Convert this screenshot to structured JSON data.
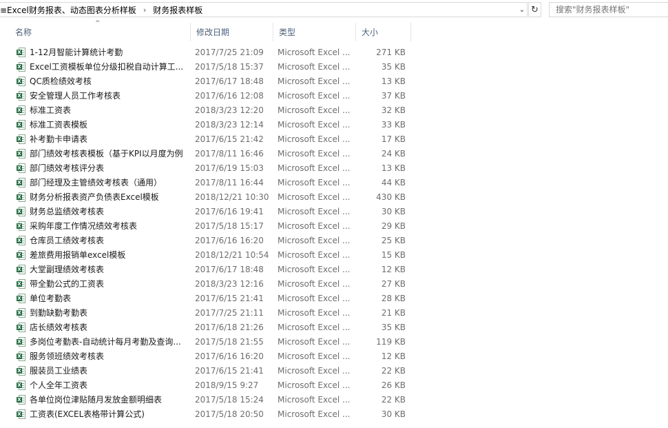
{
  "address": {
    "crumbs": [
      "≡Excel财务报表、动态图表分析样板",
      "财务报表样板"
    ],
    "separator": "›",
    "dropdown_icon": "chevron-down-icon",
    "refresh_icon": "refresh-icon"
  },
  "search": {
    "placeholder": "搜索\"财务报表样板\""
  },
  "columns": {
    "name": "名称",
    "date": "修改日期",
    "type": "类型",
    "size": "大小",
    "sort_indicator": "^"
  },
  "files": [
    {
      "name": "1-12月智能计算统计考勤",
      "date": "2017/7/25 21:09",
      "type": "Microsoft Excel ...",
      "size": "271 KB"
    },
    {
      "name": "Excel工资模板单位分级扣税自动计算工...",
      "date": "2017/5/18 15:37",
      "type": "Microsoft Excel ...",
      "size": "35 KB"
    },
    {
      "name": "QC质检绩效考核",
      "date": "2017/6/17 18:48",
      "type": "Microsoft Excel ...",
      "size": "13 KB"
    },
    {
      "name": "安全管理人员工作考核表",
      "date": "2017/6/16 12:08",
      "type": "Microsoft Excel ...",
      "size": "37 KB"
    },
    {
      "name": "标准工资表",
      "date": "2018/3/23 12:20",
      "type": "Microsoft Excel ...",
      "size": "32 KB"
    },
    {
      "name": "标准工资表模板",
      "date": "2018/3/23 12:14",
      "type": "Microsoft Excel ...",
      "size": "33 KB"
    },
    {
      "name": "补考勤卡申请表",
      "date": "2017/6/15 21:42",
      "type": "Microsoft Excel ...",
      "size": "17 KB"
    },
    {
      "name": "部门绩效考核表模板（基于KPI以月度为例",
      "date": "2017/8/11 16:46",
      "type": "Microsoft Excel ...",
      "size": "24 KB"
    },
    {
      "name": "部门绩效考核评分表",
      "date": "2017/6/19 15:03",
      "type": "Microsoft Excel ...",
      "size": "13 KB"
    },
    {
      "name": "部门经理及主管绩效考核表（通用）",
      "date": "2017/8/11 16:44",
      "type": "Microsoft Excel ...",
      "size": "44 KB"
    },
    {
      "name": "财务分析报表资产负债表Excel模板",
      "date": "2018/12/21 10:30",
      "type": "Microsoft Excel ...",
      "size": "430 KB"
    },
    {
      "name": "财务总监绩效考核表",
      "date": "2017/6/16 19:41",
      "type": "Microsoft Excel ...",
      "size": "30 KB"
    },
    {
      "name": "采购年度工作情况绩效考核表",
      "date": "2017/5/18 15:17",
      "type": "Microsoft Excel ...",
      "size": "29 KB"
    },
    {
      "name": "仓库员工绩效考核表",
      "date": "2017/6/16 16:20",
      "type": "Microsoft Excel ...",
      "size": "25 KB"
    },
    {
      "name": "差旅费用报销单excel模板",
      "date": "2018/12/21 10:54",
      "type": "Microsoft Excel ...",
      "size": "15 KB"
    },
    {
      "name": "大堂副理绩效考核表",
      "date": "2017/6/17 18:48",
      "type": "Microsoft Excel ...",
      "size": "12 KB"
    },
    {
      "name": "带全勤公式的工资表",
      "date": "2018/3/23 12:16",
      "type": "Microsoft Excel ...",
      "size": "27 KB"
    },
    {
      "name": "单位考勤表",
      "date": "2017/6/15 21:41",
      "type": "Microsoft Excel ...",
      "size": "28 KB"
    },
    {
      "name": "到勤缺勤考勤表",
      "date": "2017/7/25 21:11",
      "type": "Microsoft Excel ...",
      "size": "21 KB"
    },
    {
      "name": "店长绩效考核表",
      "date": "2017/6/18 21:26",
      "type": "Microsoft Excel ...",
      "size": "35 KB"
    },
    {
      "name": "多岗位考勤表-自动统计每月考勤及查询...",
      "date": "2017/5/18 21:55",
      "type": "Microsoft Excel ...",
      "size": "119 KB"
    },
    {
      "name": "服务领班绩效考核表",
      "date": "2017/6/16 16:20",
      "type": "Microsoft Excel ...",
      "size": "12 KB"
    },
    {
      "name": "服装员工业绩表",
      "date": "2017/6/15 21:41",
      "type": "Microsoft Excel ...",
      "size": "22 KB"
    },
    {
      "name": "个人全年工资表",
      "date": "2018/9/15 9:27",
      "type": "Microsoft Excel ...",
      "size": "26 KB"
    },
    {
      "name": "各单位岗位津贴随月发放金额明细表",
      "date": "2017/5/18 15:24",
      "type": "Microsoft Excel ...",
      "size": "22 KB"
    },
    {
      "name": "工资表(EXCEL表格带计算公式)",
      "date": "2017/5/18 20:50",
      "type": "Microsoft Excel ...",
      "size": "30 KB"
    }
  ],
  "file_icon": "excel-file-icon",
  "file_icon_badge": "X",
  "colors": {
    "header_text": "#4c607a",
    "excel_green": "#1d7044",
    "meta_text": "#6d6d6d"
  }
}
